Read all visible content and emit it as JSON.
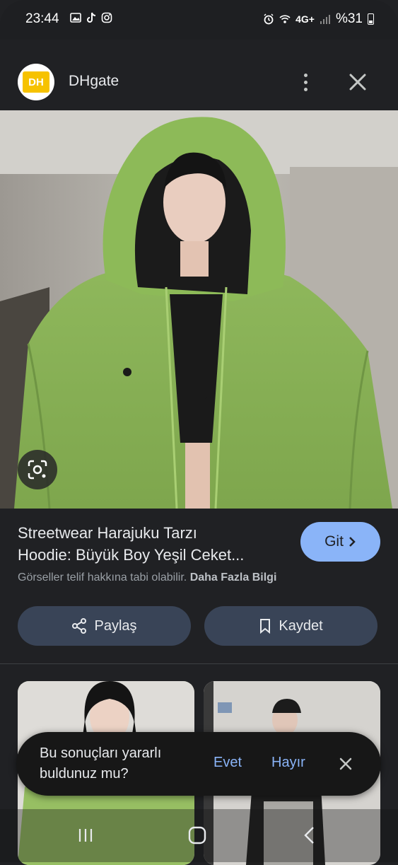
{
  "status_bar": {
    "time": "23:44",
    "battery": "%31",
    "network": "4G+"
  },
  "header": {
    "logo_text": "DH",
    "site_name": "DHgate",
    "more_icon": "more-vert-icon",
    "close_icon": "close-icon"
  },
  "main_image": {
    "icon": "lens-icon",
    "colors": {
      "jacket": "#8fb85c",
      "wall": "#b9b6b0",
      "hair": "#141414"
    }
  },
  "result": {
    "title_line1": "Streetwear Harajuku Tarzı",
    "title_line2": "Hoodie: Büyük Boy Yeşil Ceket...",
    "visit_label": "Git",
    "copyright_text": "Görseller telif hakkına tabi olabilir.",
    "learn_more": "Daha Fazla Bilgi"
  },
  "actions": {
    "share_label": "Paylaş",
    "save_label": "Kaydet"
  },
  "feedback": {
    "question": "Bu sonuçları yararlı buldunuz mu?",
    "yes": "Evet",
    "no": "Hayır"
  },
  "colors": {
    "background": "#202124",
    "accent": "#8ab4f8",
    "pill": "#394457",
    "logo_yellow": "#f6c200"
  }
}
